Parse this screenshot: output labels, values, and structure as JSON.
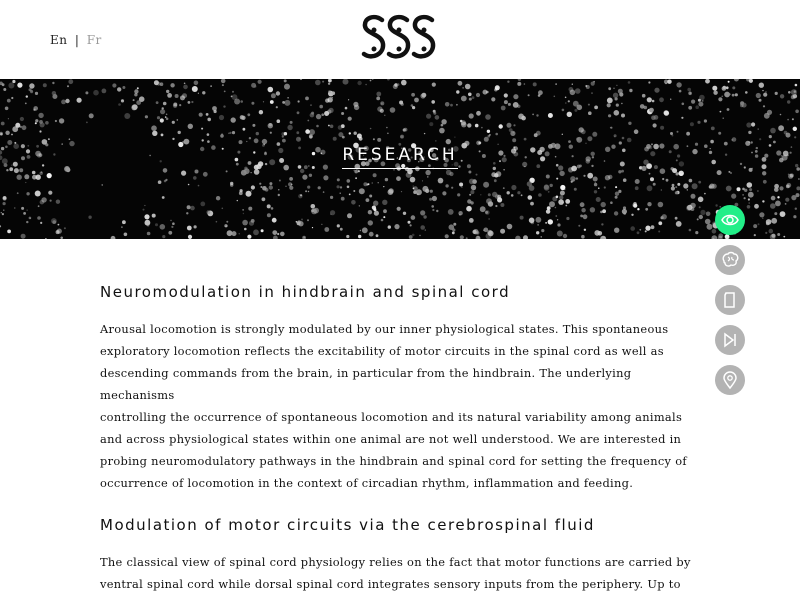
{
  "header": {
    "lang_en": "En",
    "lang_sep": "|",
    "lang_fr": "Fr",
    "logo_icon": "sss-logo"
  },
  "hero": {
    "title": "RESEARCH"
  },
  "sidenav": {
    "items": [
      {
        "icon": "eye-icon",
        "active": true
      },
      {
        "icon": "brain-icon",
        "active": false
      },
      {
        "icon": "document-icon",
        "active": false
      },
      {
        "icon": "skip-forward-icon",
        "active": false
      },
      {
        "icon": "location-pin-icon",
        "active": false
      }
    ],
    "active_color": "#22ee88",
    "inactive_color": "#b3b3b3"
  },
  "sections": [
    {
      "heading": "Neuromodulation in hindbrain and spinal cord",
      "lines": [
        "Arousal locomotion is strongly modulated by our inner physiological states. This spontaneous",
        "exploratory locomotion reflects the excitability of motor circuits in the spinal cord as well as",
        "descending commands from the brain, in particular from the hindbrain. The underlying mechanisms",
        "controlling the occurrence of spontaneous locomotion and its natural variability among animals",
        "and across physiological states within one animal are not well understood. We are interested in",
        "probing neuromodulatory pathways in the hindbrain and spinal cord for setting the frequency of",
        "occurrence of locomotion in the context of circadian rhythm, inflammation and feeding."
      ]
    },
    {
      "heading": "Modulation of motor circuits via the cerebrospinal fluid",
      "lines": [
        "The classical view of spinal cord physiology relies on the fact that motor functions are carried by",
        "ventral spinal cord while dorsal spinal cord integrates sensory inputs from the periphery. Up to"
      ]
    }
  ]
}
